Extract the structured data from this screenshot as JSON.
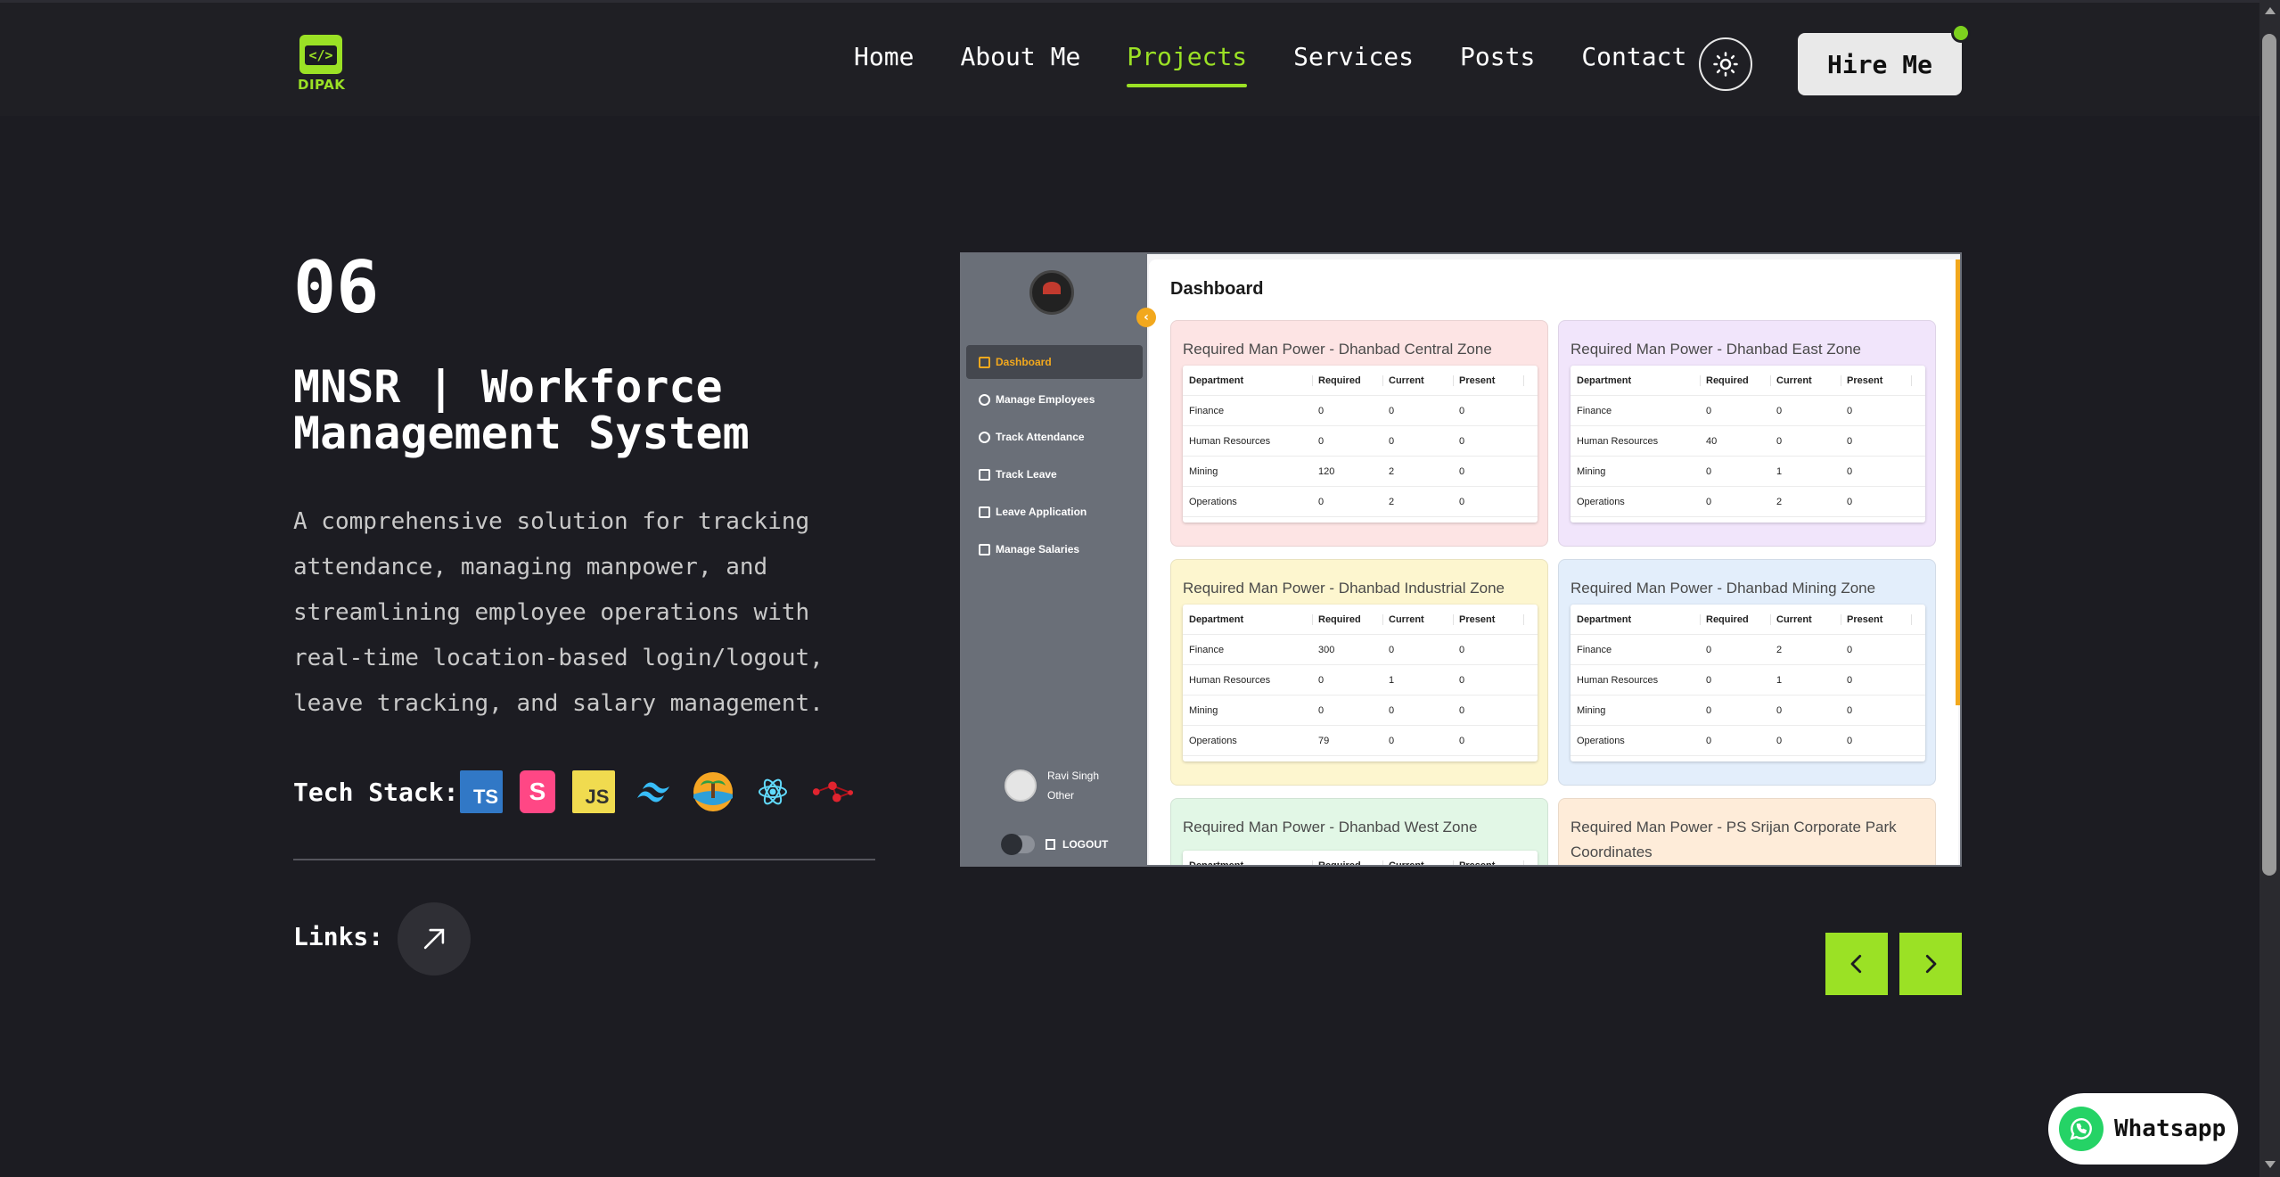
{
  "brand": {
    "name": "DIPAK",
    "logo_glyph": "</>"
  },
  "nav": {
    "items": [
      {
        "label": "Home",
        "active": false
      },
      {
        "label": "About Me",
        "active": false
      },
      {
        "label": "Projects",
        "active": true
      },
      {
        "label": "Services",
        "active": false
      },
      {
        "label": "Posts",
        "active": false
      },
      {
        "label": "Contact",
        "active": false
      }
    ],
    "theme_icon": "sun-icon",
    "hire_label": "Hire Me"
  },
  "project": {
    "number": "06",
    "title": "MNSR | Workforce Management System",
    "description": "A comprehensive solution for tracking attendance, managing manpower, and streamlining employee operations with real-time location-based login/logout, leave tracking, and salary management.",
    "tech_stack_label": "Tech Stack:",
    "tech_stack": [
      {
        "icon": "typescript-icon",
        "text": "TS",
        "color": "#3178c6"
      },
      {
        "icon": "storybook-icon",
        "text": "S",
        "color": "#ff4785"
      },
      {
        "icon": "javascript-icon",
        "text": "JS",
        "color": "#f0db4f"
      },
      {
        "icon": "tailwind-icon",
        "text": "",
        "color": "#38bdf8"
      },
      {
        "icon": "vite-icon",
        "text": "",
        "color": "#f5a623"
      },
      {
        "icon": "react-icon",
        "text": "",
        "color": "#61dafb"
      },
      {
        "icon": "nodes-icon",
        "text": "",
        "color": "#e0242f"
      }
    ],
    "links_label": "Links:",
    "link_icon": "arrow-up-right-icon"
  },
  "preview": {
    "sidebar": {
      "items": [
        {
          "label": "Dashboard",
          "active": true
        },
        {
          "label": "Manage Employees",
          "active": false
        },
        {
          "label": "Track Attendance",
          "active": false
        },
        {
          "label": "Track Leave",
          "active": false
        },
        {
          "label": "Leave Application",
          "active": false
        },
        {
          "label": "Manage Salaries",
          "active": false
        }
      ],
      "user_name": "Ravi Singh",
      "user_role": "Other",
      "logout_label": "LOGOUT"
    },
    "title": "Dashboard",
    "columns": [
      "Department",
      "Required",
      "Current",
      "Present"
    ],
    "zones": [
      {
        "title": "Required Man Power - Dhanbad Central Zone",
        "bg": "#fde4e4",
        "rows": [
          [
            "Finance",
            "0",
            "0",
            "0"
          ],
          [
            "Human Resources",
            "0",
            "0",
            "0"
          ],
          [
            "Mining",
            "120",
            "2",
            "0"
          ],
          [
            "Operations",
            "0",
            "2",
            "0"
          ]
        ]
      },
      {
        "title": "Required Man Power - Dhanbad East Zone",
        "bg": "#f1e5fb",
        "rows": [
          [
            "Finance",
            "0",
            "0",
            "0"
          ],
          [
            "Human Resources",
            "40",
            "0",
            "0"
          ],
          [
            "Mining",
            "0",
            "1",
            "0"
          ],
          [
            "Operations",
            "0",
            "2",
            "0"
          ]
        ]
      },
      {
        "title": "Required Man Power - Dhanbad Industrial Zone",
        "bg": "#fdf6cf",
        "rows": [
          [
            "Finance",
            "300",
            "0",
            "0"
          ],
          [
            "Human Resources",
            "0",
            "1",
            "0"
          ],
          [
            "Mining",
            "0",
            "0",
            "0"
          ],
          [
            "Operations",
            "79",
            "0",
            "0"
          ]
        ]
      },
      {
        "title": "Required Man Power - Dhanbad Mining Zone",
        "bg": "#e3eefb",
        "rows": [
          [
            "Finance",
            "0",
            "2",
            "0"
          ],
          [
            "Human Resources",
            "0",
            "1",
            "0"
          ],
          [
            "Mining",
            "0",
            "0",
            "0"
          ],
          [
            "Operations",
            "0",
            "0",
            "0"
          ]
        ]
      },
      {
        "title": "Required Man Power - Dhanbad West Zone",
        "bg": "#e2f7e6",
        "rows": []
      },
      {
        "title": "Required Man Power - PS Srijan Corporate Park Coordinates",
        "bg": "#feecd9",
        "rows": []
      }
    ]
  },
  "pager": {
    "prev_icon": "chevron-left-icon",
    "next_icon": "chevron-right-icon"
  },
  "whatsapp": {
    "label": "Whatsapp",
    "icon": "whatsapp-icon"
  },
  "colors": {
    "accent": "#9be125",
    "background": "#1c1c22",
    "preview_accent": "#f2a81d"
  }
}
